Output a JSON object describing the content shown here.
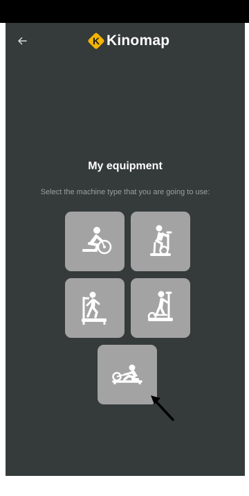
{
  "header": {
    "back_icon": "arrow-left-icon",
    "logo_text": "Kinomap",
    "logo_mark_letter": "K",
    "brand_color": "#f5b400"
  },
  "main": {
    "title": "My equipment",
    "subtitle": "Select the machine type that you are going to use:",
    "equipment": [
      {
        "icon": "handbike-icon"
      },
      {
        "icon": "exercise-bike-icon"
      },
      {
        "icon": "treadmill-icon"
      },
      {
        "icon": "elliptical-icon"
      },
      {
        "icon": "rowing-machine-icon"
      }
    ]
  },
  "colors": {
    "background": "#353a3a",
    "tile": "#a3a3a3",
    "icon": "#ffffff",
    "subtitle": "#9aa0a0"
  }
}
